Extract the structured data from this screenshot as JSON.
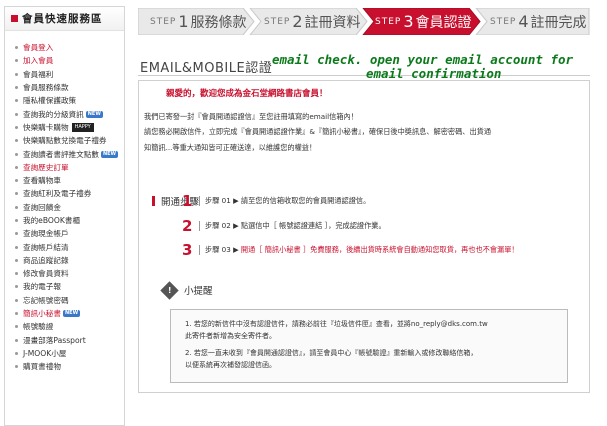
{
  "sidebar": {
    "title": "會員快速服務區",
    "items": [
      {
        "label": "會員登入",
        "red": true
      },
      {
        "label": "加入會員",
        "red": true
      },
      {
        "label": "會員福利",
        "red": false
      },
      {
        "label": "會員服務條款",
        "red": false
      },
      {
        "label": "隱私權保護政策",
        "red": false
      },
      {
        "label": "查詢我的分級資訊",
        "red": false,
        "badge": "NEW"
      },
      {
        "label": "快樂購卡購物",
        "red": false,
        "badge_dark": "HAPPY"
      },
      {
        "label": "快樂購點數兌換電子禮券",
        "red": false
      },
      {
        "label": "查詢讀者書評推文點數",
        "red": false,
        "badge": "NEW"
      },
      {
        "label": "查詢歷史訂單",
        "red": true
      },
      {
        "label": "查看購物車",
        "red": false
      },
      {
        "label": "查詢紅利及電子禮券",
        "red": false
      },
      {
        "label": "查詢回饋金",
        "red": false
      },
      {
        "label": "我的eBOOK書櫃",
        "red": false
      },
      {
        "label": "查詢現金帳戶",
        "red": false
      },
      {
        "label": "查詢帳戶結清",
        "red": false
      },
      {
        "label": "商品追蹤記錄",
        "red": false
      },
      {
        "label": "修改會員資料",
        "red": false
      },
      {
        "label": "我的電子報",
        "red": false
      },
      {
        "label": "忘記帳號密碼",
        "red": false
      },
      {
        "label": "簡訊小秘書",
        "red": true,
        "badge": "NEW"
      },
      {
        "label": "帳號驗證",
        "red": false
      },
      {
        "label": "漫畫部落Passport",
        "red": false
      },
      {
        "label": "J-MOOK小屋",
        "red": false
      },
      {
        "label": "購買書禮物",
        "red": false
      }
    ]
  },
  "steps": [
    {
      "prefix": "STEP",
      "num": "1",
      "label": "服務條款",
      "active": false
    },
    {
      "prefix": "STEP",
      "num": "2",
      "label": "註冊資料",
      "active": false
    },
    {
      "prefix": "STEP",
      "num": "3",
      "label": "會員認證",
      "active": true
    },
    {
      "prefix": "STEP",
      "num": "4",
      "label": "註冊完成",
      "active": false
    }
  ],
  "page_title": "EMAIL&MOBILE認證",
  "annotation": {
    "line1": "email check. open your email account for",
    "line2": "email confirmation"
  },
  "welcome": "親愛的，歡迎您成為金石堂網路書店會員！",
  "intro": [
    "我們已寄發一封『會員開通認證信』至您註冊填寫的email信箱內！",
    "請您務必開啟信件，立即完成『會員開通認證作業』&『簡訊小秘書』，確保日後中獎訊息、解密密碼、出貨通",
    "知簡訊...等重大通知皆可正確送達，以維護您的權益！"
  ],
  "steps_heading": "開通步驟",
  "procedure": [
    {
      "num": "1",
      "prefix": "步驟 01 ▶",
      "text": "請至您的信箱收取您的會員開通認證信。",
      "red": false
    },
    {
      "num": "2",
      "prefix": "步驟 02 ▶",
      "text": "點選信中［ 帳號認證連結 ］，完成認證作業。",
      "red": false
    },
    {
      "num": "3",
      "prefix": "步驟 03 ▶",
      "text": "開通［ 簡訊小秘書 ］免費服務，後續出貨時系統會自動通知您取貨，再也也不會漏單！",
      "red": true
    }
  ],
  "tips_heading": "小提醒",
  "tips_icon": "!",
  "tips": [
    "1.  若您的新信件中沒有認證信件，請務必前往『垃圾信件匣』查看，並將no_reply@dks.com.tw",
    "     此寄件者新增為安全寄件者。",
    "2.  若您一直未收到『會員開通認證信』，請至會員中心『帳號驗證』重新輸入或修改聯絡信箱，",
    "     以便系統再次補發認證信函。"
  ],
  "colors": {
    "brand_red": "#c8102e",
    "step_active": "#c8102e",
    "step_inactive": "#e9e9e9",
    "annotation": "#0b7a1a"
  }
}
